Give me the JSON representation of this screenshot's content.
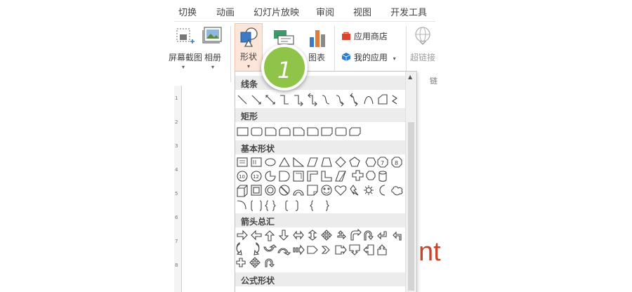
{
  "ribbon_tabs": [
    "切换",
    "动画",
    "幻灯片放映",
    "审阅",
    "视图",
    "开发工具"
  ],
  "ribbon_buttons": {
    "screenshot": "屏幕截图",
    "album": "相册",
    "shapes": "形状",
    "chart": "图表",
    "store": "应用商店",
    "my_apps": "我的应用",
    "hyperlink": "超链接",
    "group_edge_label": "链"
  },
  "step_badge": "1",
  "gallery": {
    "sections": [
      "线条",
      "矩形",
      "基本形状",
      "箭头总汇",
      "公式形状"
    ]
  },
  "slide": {
    "visible_text": "nt"
  },
  "ruler_numbers": [
    "1",
    "2",
    "3",
    "4",
    "5",
    "6",
    "7",
    "8"
  ],
  "colors": {
    "accent_green": "#8fc448",
    "shapes_highlight": "#fce5d9",
    "slide_text": "#c8462c",
    "store_icon": "#d9442f",
    "my_apps_icon": "#2b7cd3"
  },
  "icons": {
    "shapes": "shapes-icon",
    "chart": "bar-chart-icon",
    "store": "store-bag-icon",
    "my_apps": "app-cube-icon",
    "hyperlink": "globe-link-icon"
  }
}
